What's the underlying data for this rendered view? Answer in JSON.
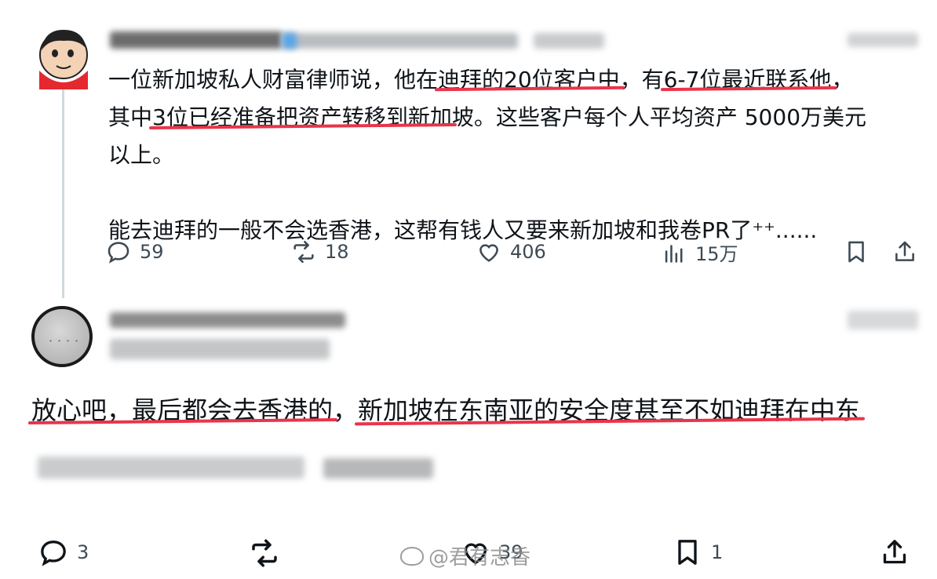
{
  "tweet1": {
    "text_line1_pre": "一位新加坡私人财富律师说，他在",
    "text_line1_u1": "迪拜的20位客户中",
    "text_line1_mid": "，有",
    "text_line1_u2": "6-7位最近联系他",
    "text_line1_post": "，",
    "text_line2_pre": "其中",
    "text_line2_u": "3位已经准备把资产转移到新加",
    "text_line2_post": "坡。这些客户每个人平均资产 5000万美元",
    "text_line3": "以上。",
    "text_para2": "能去迪拜的一般不会选香港，这帮有钱人又要来新加坡和我卷PR了⁺⁺......",
    "actions": {
      "reply_count": "59",
      "retweet_count": "18",
      "like_count": "406",
      "view_count": "15万"
    }
  },
  "reply": {
    "text_u1": "放心吧，最后都会去香港的",
    "text_mid": "，",
    "text_u2": "新加坡在东南亚的安全度甚至不如迪拜在中东",
    "actions": {
      "reply_count": "3",
      "like_count": "39",
      "bookmark_count": "1"
    }
  },
  "watermark": {
    "text": "@君有志香"
  },
  "colors": {
    "underline": "#e8354a",
    "icon": "#3d4a54",
    "thread_line": "#cfd9de"
  }
}
